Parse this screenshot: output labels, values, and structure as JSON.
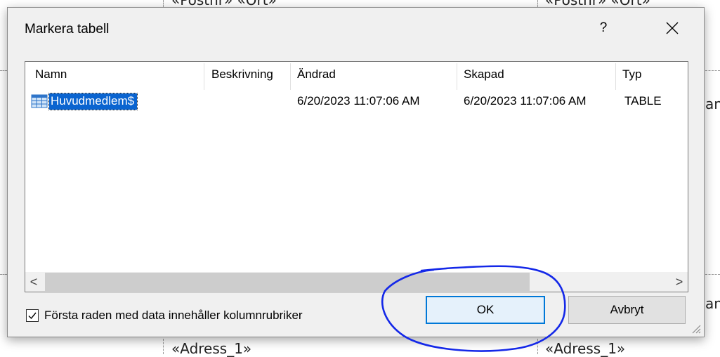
{
  "background": {
    "top_left_field": "«Postnr» «Ort»",
    "top_right_field": "«Postnr» «Ort»",
    "bottom_left_field": "«Adress_1»",
    "bottom_right_field": "«Adress_1»",
    "right_fragment_1": "an",
    "right_fragment_2": "an"
  },
  "dialog": {
    "title": "Markera tabell",
    "help_label": "?",
    "close_icon": "close-icon"
  },
  "list": {
    "columns": [
      "Namn",
      "Beskrivning",
      "Ändrad",
      "Skapad",
      "Typ"
    ],
    "rows": [
      {
        "name": "Huvudmedlem$",
        "description": "",
        "modified": "6/20/2023 11:07:06 AM",
        "created": "6/20/2023 11:07:06 AM",
        "type": "TABLE",
        "icon": "table-icon",
        "selected": true
      }
    ],
    "scroll_left": "<",
    "scroll_right": ">"
  },
  "options": {
    "first_row_headers_label": "Första raden med data innehåller kolumnrubriker",
    "first_row_headers_checked": true
  },
  "buttons": {
    "ok": "OK",
    "cancel": "Avbryt"
  },
  "colors": {
    "selection": "#0a64d0",
    "annotation_ink": "#1428e8",
    "focus_border": "#0078d7"
  }
}
